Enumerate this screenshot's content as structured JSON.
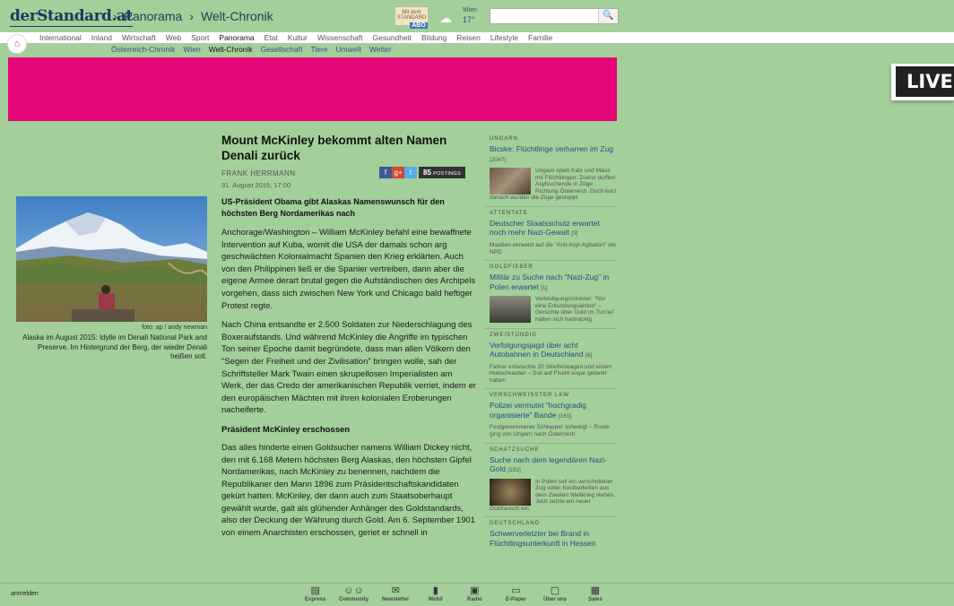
{
  "header": {
    "logo": "derStandard.at",
    "breadcrumbs": [
      "Panorama",
      "Welt-Chronik"
    ],
    "abo_small": "Mit dem STANDARD",
    "abo_label": "ABO",
    "weather_city": "Wien",
    "weather_temp": "17°",
    "search_placeholder": ""
  },
  "nav": {
    "main": [
      "International",
      "Inland",
      "Wirtschaft",
      "Web",
      "Sport",
      "Panorama",
      "Etat",
      "Kultur",
      "Wissenschaft",
      "Gesundheit",
      "Bildung",
      "Reisen",
      "Lifestyle",
      "Familie"
    ],
    "main_active": "Panorama",
    "sub": [
      "Österreich-Chronik",
      "Wien",
      "Welt-Chronik",
      "Gesellschaft",
      "Tiere",
      "Umwelt",
      "Wetter"
    ],
    "sub_active": "Welt-Chronik"
  },
  "ad": {
    "live_label": "LIVE"
  },
  "photo": {
    "credit": "foto: ap / andy newman",
    "caption": "Alaska im August 2015: Idylle im Denali National Park and Preserve. Im Hintergrund der Berg, der wieder Denali heißen soll."
  },
  "article": {
    "headline": "Mount McKinley bekommt alten Namen Denali zurück",
    "author": "FRANK HERRMANN",
    "date": "31. August 2015, 17:00",
    "postings_count": "85",
    "postings_label": "POSTINGS",
    "lead": "US-Präsident Obama gibt Alaskas Namenswunsch für den höchsten Berg Nordamerikas nach",
    "para1": "Anchorage/Washington – William McKinley befahl eine bewaffnete Intervention auf Kuba, womit die USA der damals schon arg geschwächten Kolonialmacht Spanien den Krieg erklärten. Auch von den Philippinen ließ er die Spanier vertreiben, dann aber die eigene Armee derart brutal gegen die Aufständischen des Archipels vorgehen, dass sich zwischen New York und Chicago bald heftiger Protest regte.",
    "para2": "Nach China entsandte er 2.500 Soldaten zur Niederschlagung des Boxeraufstands. Und während McKinley die Angriffe im typischen Ton seiner Epoche damit begründete, dass man allen Völkern den \"Segen der Freiheit und der Zivilisation\" bringen wolle, sah der Schriftsteller Mark Twain einen skrupellosen Imperialisten am Werk, der das Credo der amerikanischen Republik verriet, indem er den europäischen Mächten mit ihren kolonialen Eroberungen nacheiferte.",
    "subhead": "Präsident McKinley erschossen",
    "para3": "Das alles hinderte einen Goldsucher namens William Dickey nicht, den mit 6.168 Metern höchsten Berg Alaskas, den höchsten Gipfel Nordamerikas, nach McKinley zu benennen, nachdem die Republikaner den Mann 1896 zum Präsidentschaftskandidaten gekürt hatten. McKinley, der dann auch zum Staatsoberhaupt gewählt wurde, galt als glühender Anhänger des Goldstandards, also der Deckung der Währung durch Gold. Am 6. September 1901 von einem Anarchisten erschossen, geriet er schnell in"
  },
  "sidebar": [
    {
      "kicker": "UNGARN",
      "title": "Bicske: Flüchtlinge verharren im Zug",
      "count": "[2047]",
      "text": "Ungarn spielt Katz und Maus mit Flüchtlingen: Zuerst durften Asylsuchende in Züge Richtung Österreich. Doch kurz danach wurden die Züge gestoppt"
    },
    {
      "kicker": "ATTENTATE",
      "title": "Deutscher Staatsschutz erwartet noch mehr Nazi-Gewalt",
      "count": "[3]",
      "text": "Maaßen verweist auf die \"Anti-Asyl-Agitation\" der NPD"
    },
    {
      "kicker": "GOLDFIEBER",
      "title": "Militär zu Suche nach \"Nazi-Zug\" in Polen erwartet",
      "count": "[1]",
      "text": "Verteidigungsminister: \"Nur eine Erkundungsaktion\" – Gerüchte über Gold im Tunnel halten sich hartnäckig"
    },
    {
      "kicker": "ZWEISTÜNDIG",
      "title": "Verfolgungsjagd über acht Autobahnen in Deutschland",
      "count": "[6]",
      "text": "Fahrer entwischte 20 Streifenwagen und einem Hubschrauber – Soll auf Flucht sogar getankt haben"
    },
    {
      "kicker": "VERSCHWEISSTER LKW",
      "title": "Polizei vermutet \"hochgradig organisierte\" Bande",
      "count": "[160]",
      "text": "Festgenommener Schlepper schweigt – Route ging von Ungarn nach Österreich"
    },
    {
      "kicker": "SCHATZSUCHE",
      "title": "Suche nach dem legendären Nazi-Gold",
      "count": "[192]",
      "text": "In Polen soll ein verschollener Zug voller Kostbarkeiten aus dem Zweiten Weltkrieg stehen. Jetzt setzte ein neuer Goldrausch ein"
    },
    {
      "kicker": "DEUTSCHLAND",
      "title": "Schwerverletzter bei Brand in Flüchtlingsunterkunft in Hessen",
      "count": "",
      "text": ""
    }
  ],
  "footer": {
    "login": "anmelden",
    "items": [
      "Express",
      "Community",
      "Newsletter",
      "Mobil",
      "Radio",
      "E-Paper",
      "Über uns",
      "Sales"
    ]
  }
}
